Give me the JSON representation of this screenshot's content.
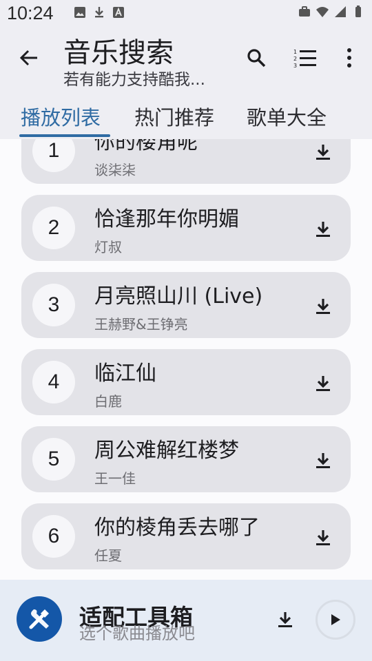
{
  "status_bar": {
    "time": "10:24",
    "left_icons": [
      "image-icon",
      "download-icon",
      "font-icon"
    ],
    "right_icons": [
      "briefcase-icon",
      "wifi-icon",
      "signal-icon",
      "battery-icon"
    ]
  },
  "app_bar": {
    "title": "音乐搜索",
    "subtitle": "若有能力支持酷我..."
  },
  "tabs": [
    {
      "label": "播放列表",
      "active": true
    },
    {
      "label": "热门推荐",
      "active": false
    },
    {
      "label": "歌单大全",
      "active": false
    }
  ],
  "songs": [
    {
      "num": "1",
      "title": "你的楼角呢",
      "artist": "谈柒柒"
    },
    {
      "num": "2",
      "title": "恰逢那年你明媚",
      "artist": "灯叔"
    },
    {
      "num": "3",
      "title": "月亮照山川 (Live)",
      "artist": "王赫野&王铮亮"
    },
    {
      "num": "4",
      "title": "临江仙",
      "artist": "白鹿"
    },
    {
      "num": "5",
      "title": "周公难解红楼梦",
      "artist": "王一佳"
    },
    {
      "num": "6",
      "title": "你的棱角丢去哪了",
      "artist": "任夏"
    }
  ],
  "player": {
    "title": "适配工具箱",
    "subtitle": "选个歌曲播放吧"
  },
  "colors": {
    "accent": "#2f6ba3",
    "card": "#e3e3e8",
    "player_bg": "#e6ecf5",
    "logo_bg": "#1457a8"
  }
}
